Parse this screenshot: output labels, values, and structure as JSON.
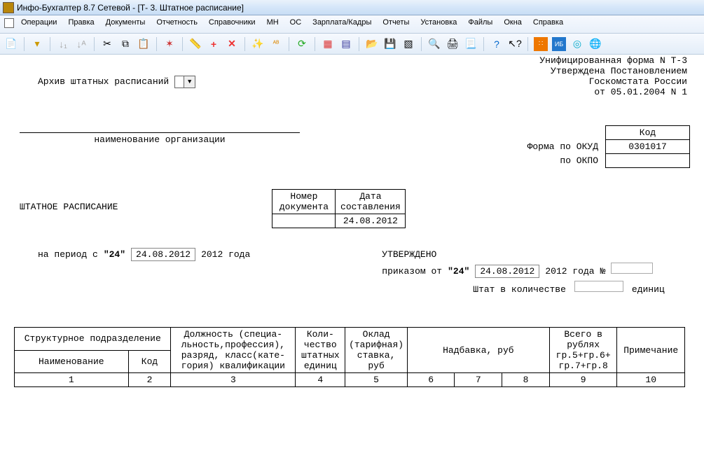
{
  "window": {
    "title": "Инфо-Бухгалтер 8.7 Сетевой - [Т- 3. Штатное расписание]"
  },
  "menu": {
    "operations": "Операции",
    "edit": "Правка",
    "documents": "Документы",
    "reports": "Отчетность",
    "refs": "Справочники",
    "mn": "МН",
    "os": "ОС",
    "salary": "Зарплата/Кадры",
    "reports2": "Отчеты",
    "setup": "Установка",
    "files": "Файлы",
    "windows": "Окна",
    "help": "Справка"
  },
  "doc": {
    "archive_label": "Архив штатных расписаний",
    "form_line1": "Унифицированная форма N Т-3",
    "form_line2": "Утверждена Постановлением",
    "form_line3": "Госкомстата России",
    "form_line4": "от 05.01.2004 N 1",
    "org_caption": "наименование организации",
    "kod": "Код",
    "okud_label": "Форма по ОКУД",
    "okud_val": "0301017",
    "okpo_label": "по ОКПО",
    "okpo_val": "",
    "title": "ШТАТНОЕ РАСПИСАНИЕ",
    "num_label": "Номер документа",
    "date_label": "Дата составления",
    "num_val": "",
    "date_val": "24.08.2012",
    "period_prefix": "на  период с",
    "period_day": "\"24\"",
    "period_date": "24.08.2012",
    "period_suffix": "2012 года",
    "approved": "УТВЕРЖДЕНО",
    "order_prefix": "приказом от",
    "order_day": "\"24\"",
    "order_date": "24.08.2012",
    "order_suffix": "2012 года",
    "order_num_sign": "№",
    "staff_prefix": "Штат в количестве",
    "staff_suffix": "единиц"
  },
  "table": {
    "h_struct": "Структурное подразделение",
    "h_name": "Наименование",
    "h_code": "Код",
    "h_position": "Должность (специа- льность,профессия), разряд, класс(кате- гория) квалификации",
    "h_qty": "Коли- чество штатных единиц",
    "h_salary": "Оклад (тарифная) ставка, руб",
    "h_addon": "Надбавка, руб",
    "h_total": "Всего в рублях гр.5+гр.6+ гр.7+гр.8",
    "h_note": "Примечание",
    "n1": "1",
    "n2": "2",
    "n3": "3",
    "n4": "4",
    "n5": "5",
    "n6": "6",
    "n7": "7",
    "n8": "8",
    "n9": "9",
    "n10": "10"
  }
}
